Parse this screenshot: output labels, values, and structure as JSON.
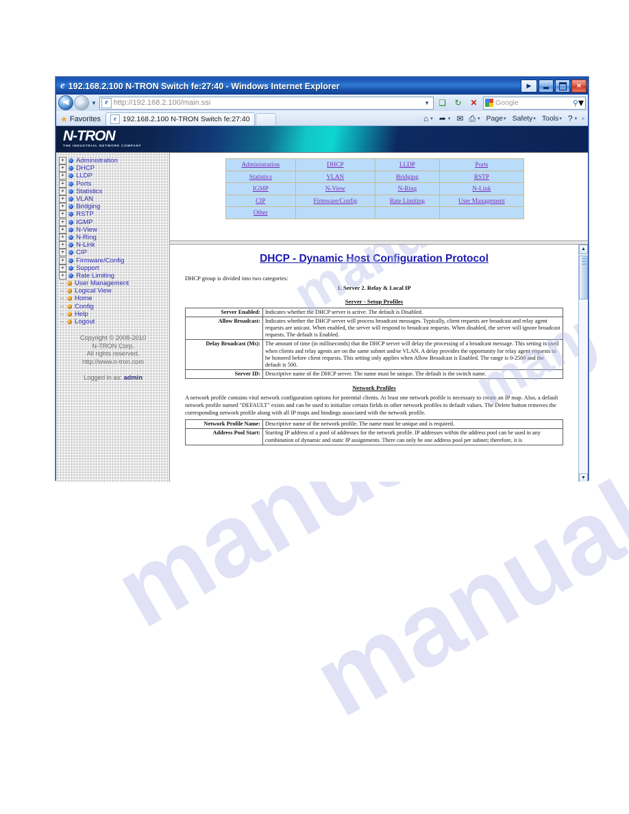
{
  "watermark": {
    "text": "manualslib"
  },
  "window": {
    "title": "192.168.2.100 N-TRON Switch fe:27:40 - Windows Internet Explorer",
    "ie_glyph": "e",
    "controls": {
      "play": "▶",
      "minimize": "minimize",
      "maximize": "maximize",
      "close": "✕"
    }
  },
  "addressbar": {
    "back": "◀",
    "forward": "▶",
    "history_caret": "▼",
    "url": "http://192.168.2.100/main.ssi",
    "url_caret": "▼",
    "compat_icon": "❑",
    "refresh_icon": "↻",
    "stop_icon": "✕",
    "search_placeholder": "Google",
    "search_go": "⚲",
    "search_caret": "▾"
  },
  "favbar": {
    "favorites_label": "Favorites",
    "star_icon": "★",
    "tab_title": "192.168.2.100 N-TRON Switch fe:27:40",
    "tab_favicon": "e"
  },
  "commandbar": {
    "home_icon": "⌂",
    "feeds_icon": "➦",
    "mail_icon": "✉",
    "print_icon": "⎙",
    "caret": "▾",
    "items": [
      {
        "label": "Page"
      },
      {
        "label": "Safety"
      },
      {
        "label": "Tools"
      }
    ],
    "help_icon": "?",
    "overflow": "»"
  },
  "banner": {
    "logo_text": "N-TRON",
    "logo_tagline": "THE INDUSTRIAL NETWORK COMPANY"
  },
  "sidebar": {
    "tree": [
      {
        "label": "Administration",
        "expandable": true,
        "dot": "blue"
      },
      {
        "label": "DHCP",
        "expandable": true,
        "dot": "blue"
      },
      {
        "label": "LLDP",
        "expandable": true,
        "dot": "blue"
      },
      {
        "label": "Ports",
        "expandable": true,
        "dot": "blue"
      },
      {
        "label": "Statistics",
        "expandable": true,
        "dot": "blue"
      },
      {
        "label": "VLAN",
        "expandable": true,
        "dot": "blue"
      },
      {
        "label": "Bridging",
        "expandable": true,
        "dot": "blue"
      },
      {
        "label": "RSTP",
        "expandable": true,
        "dot": "blue"
      },
      {
        "label": "IGMP",
        "expandable": true,
        "dot": "blue"
      },
      {
        "label": "N-View",
        "expandable": true,
        "dot": "blue"
      },
      {
        "label": "N-Ring",
        "expandable": true,
        "dot": "blue"
      },
      {
        "label": "N-Link",
        "expandable": true,
        "dot": "blue"
      },
      {
        "label": "CIP",
        "expandable": true,
        "dot": "blue"
      },
      {
        "label": "Firmware/Config",
        "expandable": true,
        "dot": "blue"
      },
      {
        "label": "Support",
        "expandable": true,
        "dot": "blue"
      },
      {
        "label": "Rate Limiting",
        "expandable": true,
        "dot": "blue"
      },
      {
        "label": "User Management",
        "expandable": false,
        "dot": "orange"
      },
      {
        "label": "Logical View",
        "expandable": false,
        "dot": "orange"
      },
      {
        "label": "Home",
        "expandable": false,
        "dot": "orange"
      },
      {
        "label": "Config",
        "expandable": false,
        "dot": "orange"
      },
      {
        "label": "Help",
        "expandable": false,
        "dot": "orange"
      },
      {
        "label": "Logout",
        "expandable": false,
        "dot": "orange"
      }
    ],
    "expander_plus": "+",
    "expander_leaf": "–",
    "copyright_line1": "Copyright © 2008-2010",
    "copyright_line2": "N-TRON Corp.",
    "copyright_line3": "All rights reserved.",
    "copyright_line4": "http://www.n-tron.com",
    "logged_in_prefix": "Logged in as:",
    "logged_in_user": "admin"
  },
  "navtable": {
    "rows": [
      [
        "Administration",
        "DHCP",
        "LLDP",
        "Ports"
      ],
      [
        "Statistics",
        "VLAN",
        "Bridging",
        "RSTP"
      ],
      [
        "IGMP",
        "N-View",
        "N-Ring",
        "N-Link"
      ],
      [
        "CIP",
        "Firmware/Config",
        "Rate Limiting",
        "User Management"
      ],
      [
        "Other",
        "",
        "",
        ""
      ]
    ]
  },
  "document": {
    "heading": "DHCP - Dynamic Host Configuration Protocol",
    "intro": "DHCP group is divided into two categories:",
    "categories": "1. Server   2. Relay & Local IP",
    "section1_title": "Server - Setup Profiles",
    "section1_rows": [
      {
        "key": "Server Enabled:",
        "value": "Indicates whether the DHCP server is active. The default is Disabled."
      },
      {
        "key": "Allow Broadcast:",
        "value": "Indicates whether the DHCP server will process broadcast messages. Typically, client requests are broadcast and relay agent requests are unicast. When enabled, the server will respond to broadcast requests. When disabled, the server will ignore broadcast requests. The default is Enabled."
      },
      {
        "key": "Delay Broadcast (Ms):",
        "value": "The amount of time (in milliseconds) that the DHCP server will delay the processing of a broadcast message. This setting is used when clients and relay agents are on the same subnet and/or VLAN. A delay provides the opportunity for relay agent requests to be honored before client requests. This setting only applies when Allow Broadcast is Enabled. The range is 0-2500 and the default is 500."
      },
      {
        "key": "Server ID:",
        "value": "Descriptive name of the DHCP server. The name must be unique. The default is the switch name."
      }
    ],
    "section2_title": "Network Profiles",
    "section2_para": "A network profile contains vital network configuration options for potential clients. At least one network profile is necessary to create an IP map. Also, a default network profile named \"DEFAULT\" exists and can be used to initialize certain fields in other network profiles to default values. The Delete button removes the corresponding network profile along with all IP maps and bindings associated with the network profile.",
    "section2_rows": [
      {
        "key": "Network Profile Name:",
        "value": "Descriptive name of the network profile. The name must be unique and is required."
      },
      {
        "key": "Address Pool Start:",
        "value": "Starting IP address of a pool of addresses for the network profile. IP addresses within the address pool can be used in any combination of dynamic and static IP assignments. There can only be one address pool per subnet; therefore, it is"
      }
    ]
  },
  "scrollbar": {
    "up_arrow": "▲",
    "down_arrow": "▼"
  }
}
